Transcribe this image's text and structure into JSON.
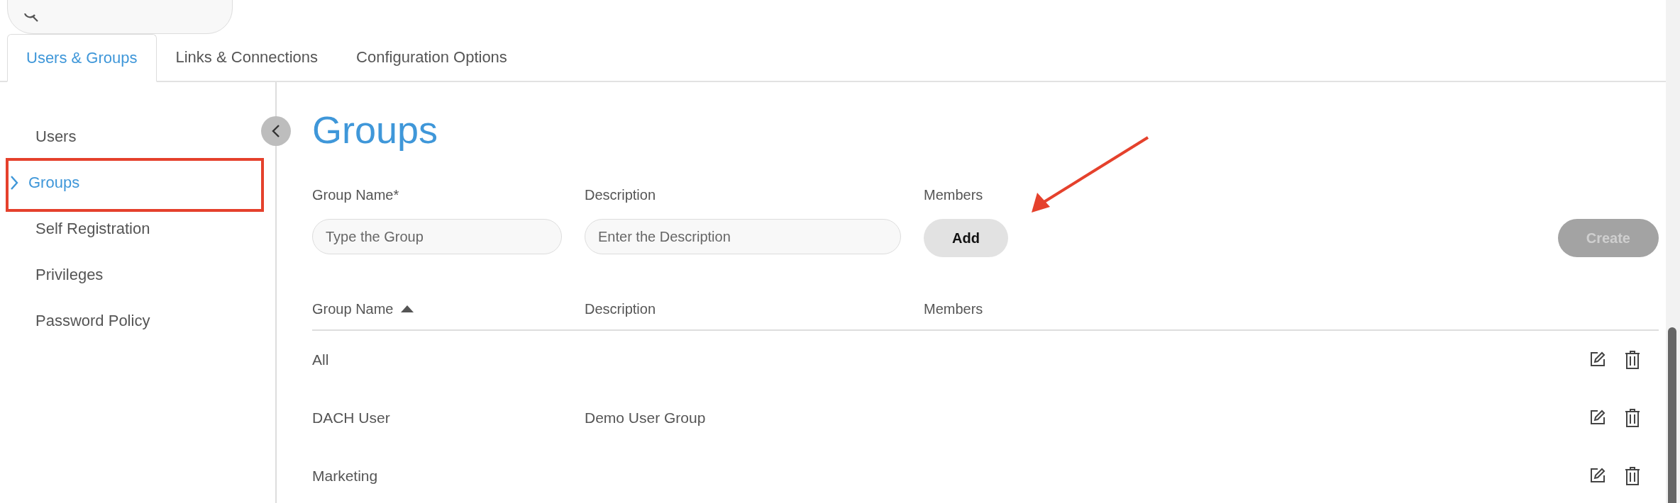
{
  "tabs": [
    {
      "label": "Users & Groups",
      "selected": true
    },
    {
      "label": "Links & Connections",
      "selected": false
    },
    {
      "label": "Configuration Options",
      "selected": false
    }
  ],
  "sidebar": {
    "items": [
      {
        "label": "Users",
        "selected": false
      },
      {
        "label": "Groups",
        "selected": true
      },
      {
        "label": "Self Registration",
        "selected": false
      },
      {
        "label": "Privileges",
        "selected": false
      },
      {
        "label": "Password Policy",
        "selected": false
      }
    ]
  },
  "page": {
    "title": "Groups"
  },
  "form": {
    "fields": [
      {
        "label": "Group Name*",
        "placeholder": "Type the Group"
      },
      {
        "label": "Description",
        "placeholder": "Enter the Description"
      }
    ],
    "members": {
      "label": "Members",
      "button": "Add"
    },
    "create": {
      "label": "Create",
      "disabled": true
    }
  },
  "table": {
    "columns": [
      {
        "label": "Group Name",
        "sorted": true
      },
      {
        "label": "Description",
        "sorted": false
      },
      {
        "label": "Members",
        "sorted": false
      }
    ],
    "rows": [
      {
        "group_name": "All"
      },
      {
        "group_name": "DACH User",
        "description": "Demo User Group"
      },
      {
        "group_name": "Marketing"
      }
    ]
  }
}
